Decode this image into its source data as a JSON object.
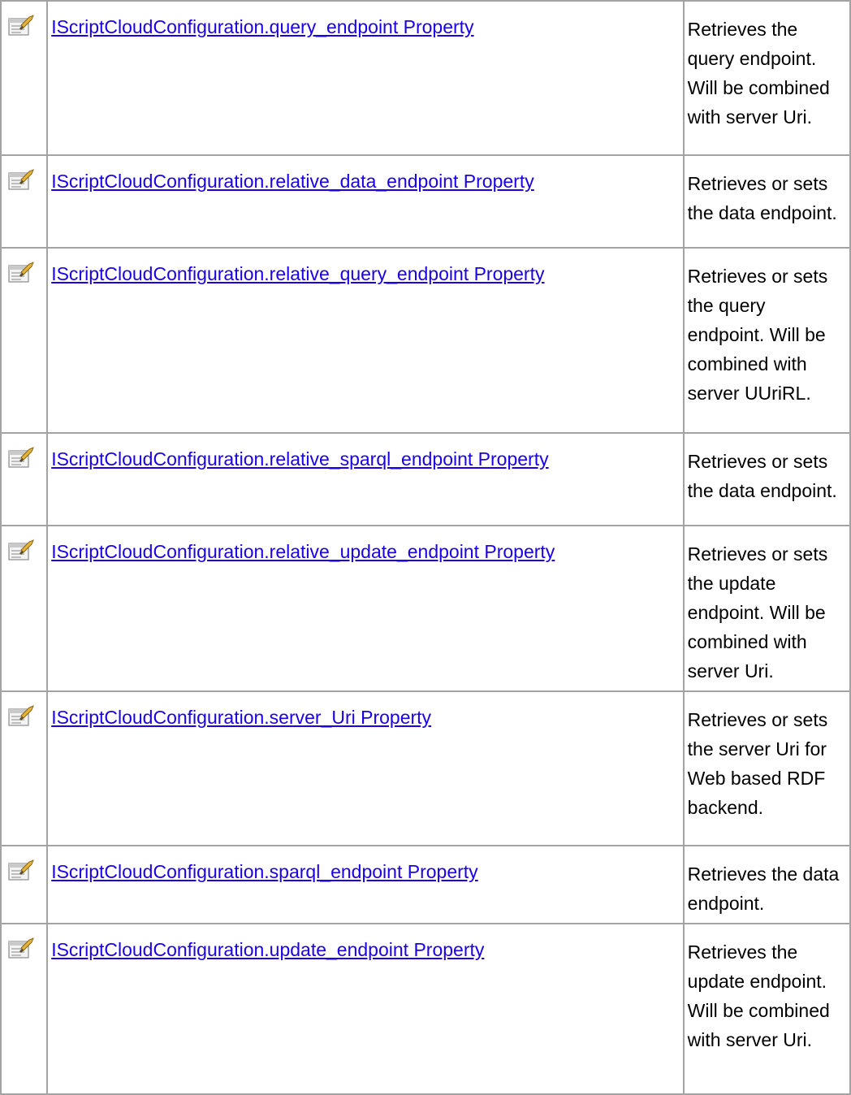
{
  "rows": [
    {
      "icon": "property-icon",
      "link": "IScriptCloudConfiguration.query_endpoint Property",
      "desc": "Retrieves the query endpoint. Will be combined with server Uri."
    },
    {
      "icon": "property-icon",
      "link": "IScriptCloudConfiguration.relative_data_endpoint Property",
      "desc": "Retrieves or sets the data endpoint."
    },
    {
      "icon": "property-icon",
      "link": "IScriptCloudConfiguration.relative_query_endpoint Property",
      "desc": "Retrieves or sets the query endpoint. Will be combined with server UUriRL."
    },
    {
      "icon": "property-icon",
      "link": "IScriptCloudConfiguration.relative_sparql_endpoint Property",
      "desc": "Retrieves or sets the data endpoint."
    },
    {
      "icon": "property-icon",
      "link": "IScriptCloudConfiguration.relative_update_endpoint Property",
      "desc": "Retrieves or sets the update endpoint. Will be combined with server Uri."
    },
    {
      "icon": "property-icon",
      "link": "IScriptCloudConfiguration.server_Uri Property",
      "desc": "Retrieves or sets the server Uri for Web based RDF backend."
    },
    {
      "icon": "property-icon",
      "link": "IScriptCloudConfiguration.sparql_endpoint Property",
      "desc": "Retrieves the data endpoint."
    },
    {
      "icon": "property-icon",
      "link": "IScriptCloudConfiguration.update_endpoint Property",
      "desc": "Retrieves the update endpoint. Will be combined with server Uri."
    }
  ],
  "colors": {
    "link": "#1a00e8",
    "border": "#a3a3a3"
  }
}
